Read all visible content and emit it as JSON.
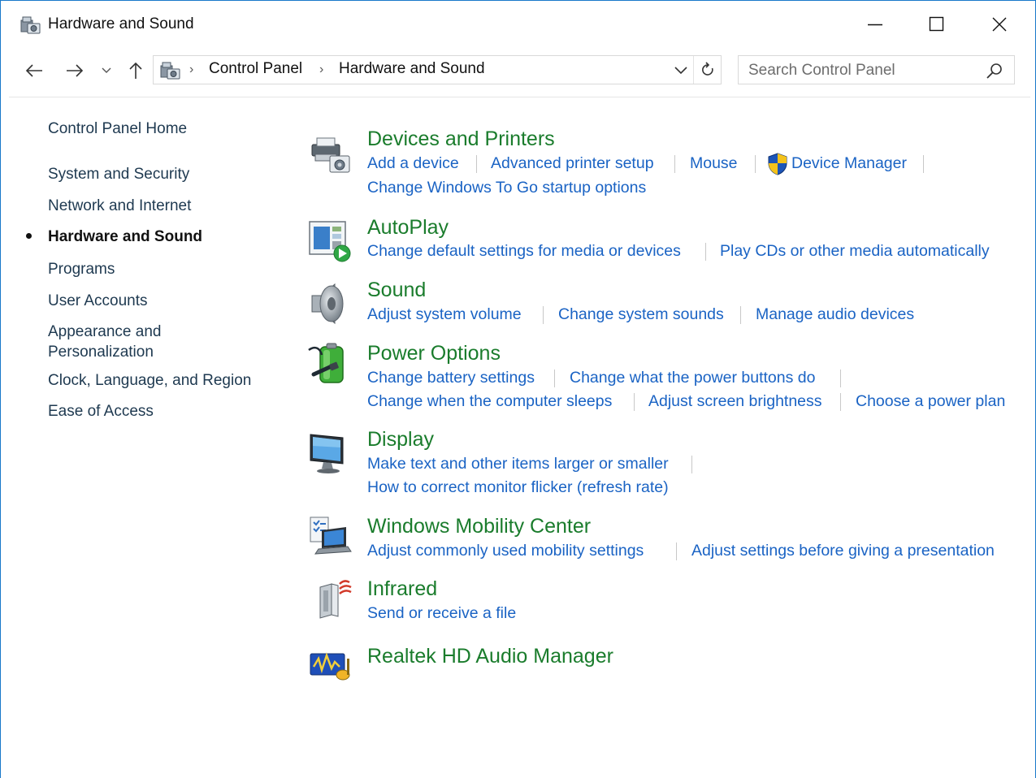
{
  "window": {
    "title": "Hardware and Sound",
    "controls": [
      "minimize",
      "maximize",
      "close"
    ],
    "accent": "#1979ca"
  },
  "address": {
    "breadcrumb": [
      "Control Panel",
      "Hardware and Sound"
    ],
    "search_placeholder": "Search Control Panel"
  },
  "sidebar": {
    "home": "Control Panel Home",
    "items": [
      {
        "label": "System and Security"
      },
      {
        "label": "Network and Internet"
      },
      {
        "label": "Hardware and Sound",
        "current": true
      },
      {
        "label": "Programs"
      },
      {
        "label": "User Accounts"
      },
      {
        "label": "Appearance and Personalization"
      },
      {
        "label": "Clock, Language, and Region"
      },
      {
        "label": "Ease of Access"
      }
    ]
  },
  "colors": {
    "category_title": "#1a7c2c",
    "link": "#1a63c4",
    "nav_link": "#1e3950"
  },
  "categories": [
    {
      "title": "Devices and Printers",
      "icon": "printer-icon",
      "links": [
        "Add a device",
        "Advanced printer setup",
        "Mouse",
        "Device Manager",
        "Change Windows To Go startup options"
      ]
    },
    {
      "title": "AutoPlay",
      "icon": "autoplay-icon",
      "links": [
        "Change default settings for media or devices",
        "Play CDs or other media automatically"
      ]
    },
    {
      "title": "Sound",
      "icon": "speaker-icon",
      "links": [
        "Adjust system volume",
        "Change system sounds",
        "Manage audio devices"
      ]
    },
    {
      "title": "Power Options",
      "icon": "battery-icon",
      "links": [
        "Change battery settings",
        "Change what the power buttons do",
        "Change when the computer sleeps",
        "Adjust screen brightness",
        "Choose a power plan"
      ]
    },
    {
      "title": "Display",
      "icon": "monitor-icon",
      "links": [
        "Make text and other items larger or smaller",
        "How to correct monitor flicker (refresh rate)"
      ]
    },
    {
      "title": "Windows Mobility Center",
      "icon": "mobility-icon",
      "links": [
        "Adjust commonly used mobility settings",
        "Adjust settings before giving a presentation"
      ]
    },
    {
      "title": "Infrared",
      "icon": "infrared-icon",
      "links": [
        "Send or receive a file"
      ]
    },
    {
      "title": "Realtek HD Audio Manager",
      "icon": "realtek-audio-icon",
      "links": []
    }
  ]
}
